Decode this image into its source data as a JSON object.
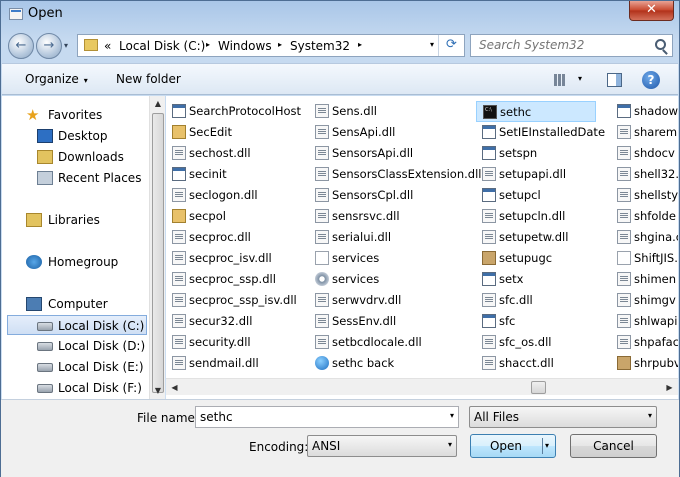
{
  "window": {
    "title": "Open",
    "close_label": "✕"
  },
  "nav": {
    "back_glyph": "←",
    "forward_glyph": "→",
    "dropdown_glyph": "▾"
  },
  "address": {
    "prefix": "«",
    "segments": [
      "Local Disk (C:)",
      "Windows",
      "System32"
    ],
    "separator": "▸",
    "dropdown_glyph": "▾",
    "refresh_glyph": "⟳"
  },
  "search": {
    "placeholder": "Search System32"
  },
  "toolbar": {
    "organize_label": "Organize",
    "new_folder_label": "New folder",
    "caret": "▾",
    "help_label": "?"
  },
  "sidebar": {
    "items": [
      {
        "label": "Favorites",
        "icon": "star-icon"
      },
      {
        "label": "Desktop",
        "icon": "desktop-icon"
      },
      {
        "label": "Downloads",
        "icon": "downloads-folder-icon"
      },
      {
        "label": "Recent Places",
        "icon": "recent-places-icon"
      },
      {
        "label": "Libraries",
        "icon": "libraries-icon"
      },
      {
        "label": "Homegroup",
        "icon": "homegroup-icon"
      },
      {
        "label": "Computer",
        "icon": "computer-icon"
      },
      {
        "label": "Local Disk (C:)",
        "icon": "drive-icon",
        "selected": true
      },
      {
        "label": "Local Disk (D:)",
        "icon": "drive-icon"
      },
      {
        "label": "Local Disk (E:)",
        "icon": "drive-icon"
      },
      {
        "label": "Local Disk (F:)",
        "icon": "drive-icon"
      }
    ]
  },
  "scroll": {
    "up": "▲",
    "down": "▼",
    "left": "◀",
    "right": "▶"
  },
  "files": {
    "columns": [
      [
        {
          "name": "SearchProtocolHost",
          "icon": "exe"
        },
        {
          "name": "SecEdit",
          "icon": "sec"
        },
        {
          "name": "sechost.dll",
          "icon": "dll"
        },
        {
          "name": "secinit",
          "icon": "exe"
        },
        {
          "name": "seclogon.dll",
          "icon": "dll"
        },
        {
          "name": "secpol",
          "icon": "sec"
        },
        {
          "name": "secproc.dll",
          "icon": "dll"
        },
        {
          "name": "secproc_isv.dll",
          "icon": "dll"
        },
        {
          "name": "secproc_ssp.dll",
          "icon": "dll"
        },
        {
          "name": "secproc_ssp_isv.dll",
          "icon": "dll"
        },
        {
          "name": "secur32.dll",
          "icon": "dll"
        },
        {
          "name": "security.dll",
          "icon": "dll"
        },
        {
          "name": "sendmail.dll",
          "icon": "dll"
        }
      ],
      [
        {
          "name": "Sens.dll",
          "icon": "dll"
        },
        {
          "name": "SensApi.dll",
          "icon": "dll"
        },
        {
          "name": "SensorsApi.dll",
          "icon": "dll"
        },
        {
          "name": "SensorsClassExtension.dll",
          "icon": "dll"
        },
        {
          "name": "SensorsCpl.dll",
          "icon": "dll"
        },
        {
          "name": "sensrsvc.dll",
          "icon": "dll"
        },
        {
          "name": "serialui.dll",
          "icon": "dll"
        },
        {
          "name": "services",
          "icon": "txt"
        },
        {
          "name": "services",
          "icon": "gear"
        },
        {
          "name": "serwvdrv.dll",
          "icon": "dll"
        },
        {
          "name": "SessEnv.dll",
          "icon": "dll"
        },
        {
          "name": "setbcdlocale.dll",
          "icon": "dll"
        },
        {
          "name": "sethc back",
          "icon": "globe"
        }
      ],
      [
        {
          "name": "sethc",
          "icon": "cmd",
          "selected": true
        },
        {
          "name": "SetIEInstalledDate",
          "icon": "exe"
        },
        {
          "name": "setspn",
          "icon": "exe"
        },
        {
          "name": "setupapi.dll",
          "icon": "dll"
        },
        {
          "name": "setupcl",
          "icon": "exe"
        },
        {
          "name": "setupcln.dll",
          "icon": "dll"
        },
        {
          "name": "setupetw.dll",
          "icon": "dll"
        },
        {
          "name": "setupugc",
          "icon": "box"
        },
        {
          "name": "setx",
          "icon": "exe"
        },
        {
          "name": "sfc.dll",
          "icon": "dll"
        },
        {
          "name": "sfc",
          "icon": "exe"
        },
        {
          "name": "sfc_os.dll",
          "icon": "dll"
        },
        {
          "name": "shacct.dll",
          "icon": "dll"
        }
      ],
      [
        {
          "name": "shadow",
          "icon": "exe"
        },
        {
          "name": "sharem",
          "icon": "dll"
        },
        {
          "name": "shdocv",
          "icon": "dll"
        },
        {
          "name": "shell32.",
          "icon": "dll"
        },
        {
          "name": "shellsty",
          "icon": "dll"
        },
        {
          "name": "shfolde",
          "icon": "dll"
        },
        {
          "name": "shgina.c",
          "icon": "dll"
        },
        {
          "name": "ShiftJIS.",
          "icon": "txt"
        },
        {
          "name": "shimen",
          "icon": "dll"
        },
        {
          "name": "shimgv",
          "icon": "dll"
        },
        {
          "name": "shlwapi",
          "icon": "dll"
        },
        {
          "name": "shpafac",
          "icon": "dll"
        },
        {
          "name": "shrpubv",
          "icon": "box"
        }
      ]
    ]
  },
  "bottom": {
    "file_name_label": "File name:",
    "file_name_value": "sethc",
    "file_type_value": "All Files",
    "encoding_label": "Encoding:",
    "encoding_value": "ANSI",
    "open_label": "Open",
    "cancel_label": "Cancel",
    "dropdown_glyph": "▾"
  }
}
